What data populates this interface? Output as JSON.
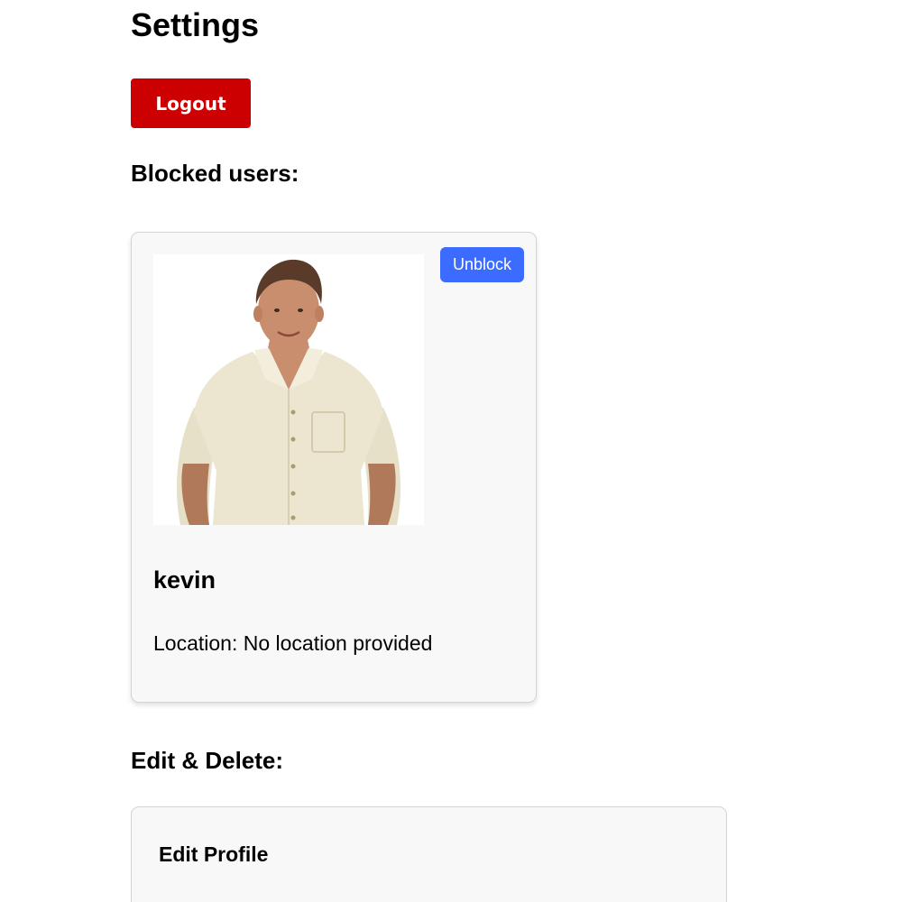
{
  "page": {
    "title": "Settings",
    "logout_label": "Logout"
  },
  "blocked": {
    "heading": "Blocked users:",
    "users": [
      {
        "name": "kevin",
        "location": "Location: No location provided",
        "unblock_label": "Unblock"
      }
    ]
  },
  "edit_delete": {
    "heading": "Edit & Delete:",
    "card_title": "Edit Profile"
  },
  "colors": {
    "logout_bg": "#cc0000",
    "unblock_bg": "#3b6cff",
    "card_bg": "#f8f8f8"
  }
}
